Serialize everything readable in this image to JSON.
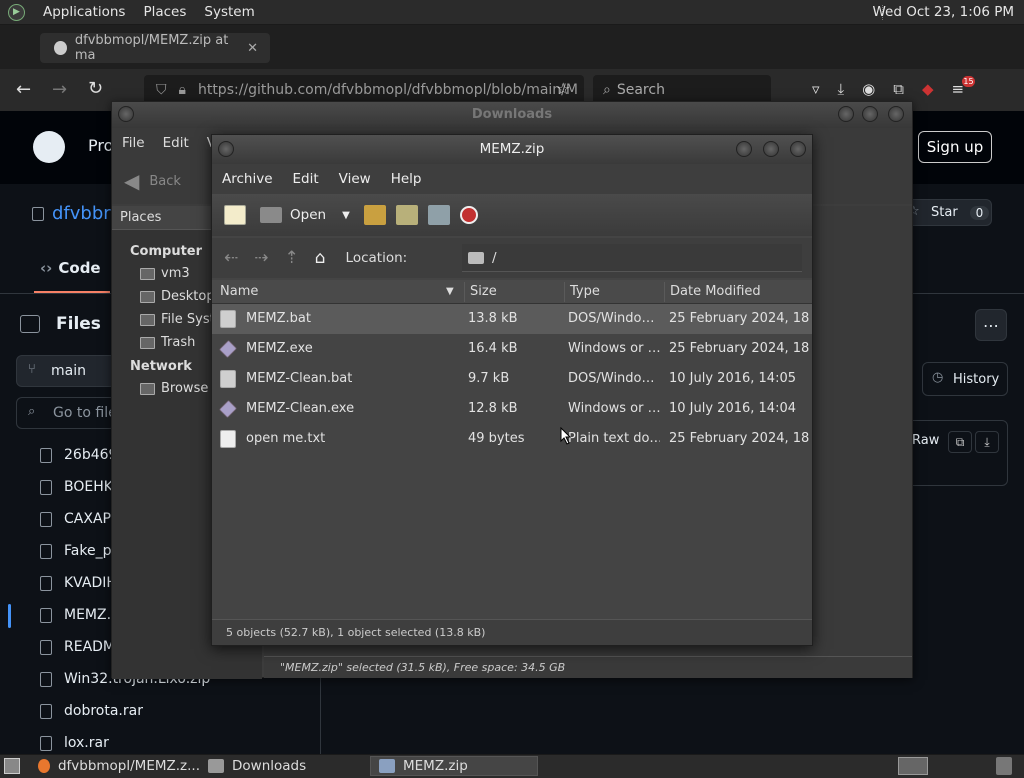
{
  "top_panel": {
    "menus": [
      "Applications",
      "Places",
      "System"
    ],
    "clock": "Wed Oct 23,  1:06 PM"
  },
  "firefox": {
    "tab_title": "dfvbbmopl/MEMZ.zip at ma",
    "url": "https://github.com/dfvbbmopl/dfvbbmopl/blob/main/M",
    "search_placeholder": "Search",
    "badge_count": "15"
  },
  "github": {
    "header_partial": "Pro",
    "signup": "Sign up",
    "repo_partial": "dfvbbr",
    "code_tab": "Code",
    "files_title": "Files",
    "branch": "main",
    "goto_placeholder": "Go to file",
    "star_label": "Star",
    "star_count": "0",
    "history_label": "History",
    "raw_label": "Raw",
    "file_items": [
      "26b469",
      "BOEHK",
      "CAXAP",
      "Fake_p",
      "KVADIH",
      "MEMZ.",
      "READM",
      "Win32.trojan.Lixo.zip",
      "dobrota.rar",
      "lox.rar"
    ]
  },
  "downloads": {
    "title": "Downloads",
    "menus": [
      "File",
      "Edit",
      "V"
    ],
    "back_label": "Back",
    "places_label": "Places",
    "computer_header": "Computer",
    "computer_items": [
      "vm3",
      "Desktop",
      "File Syst",
      "Trash"
    ],
    "network_header": "Network",
    "network_items": [
      "Browse N"
    ],
    "status": "\"MEMZ.zip\" selected (31.5 kB), Free space: 34.5 GB"
  },
  "archive": {
    "title": "MEMZ.zip",
    "menus": [
      "Archive",
      "Edit",
      "View",
      "Help"
    ],
    "open_label": "Open",
    "location_label": "Location:",
    "location_value": "/",
    "columns": [
      "Name",
      "Size",
      "Type",
      "Date Modified"
    ],
    "files": [
      {
        "name": "MEMZ.bat",
        "size": "13.8 kB",
        "type": "DOS/Windo…",
        "date": "25 February 2024, 18…",
        "icon": "bat",
        "selected": true
      },
      {
        "name": "MEMZ.exe",
        "size": "16.4 kB",
        "type": "Windows or …",
        "date": "25 February 2024, 18…",
        "icon": "exe",
        "selected": false
      },
      {
        "name": "MEMZ-Clean.bat",
        "size": "9.7 kB",
        "type": "DOS/Windo…",
        "date": "10 July 2016, 14:05",
        "icon": "bat",
        "selected": false
      },
      {
        "name": "MEMZ-Clean.exe",
        "size": "12.8 kB",
        "type": "Windows or …",
        "date": "10 July 2016, 14:04",
        "icon": "exe",
        "selected": false
      },
      {
        "name": "open me.txt",
        "size": "49 bytes",
        "type": "Plain text do…",
        "date": "25 February 2024, 18…",
        "icon": "txt",
        "selected": false
      }
    ],
    "status": "5 objects (52.7 kB), 1 object selected (13.8 kB)"
  },
  "taskbar": {
    "tasks": [
      "dfvbbmopl/MEMZ.z...",
      "Downloads",
      "MEMZ.zip"
    ]
  }
}
